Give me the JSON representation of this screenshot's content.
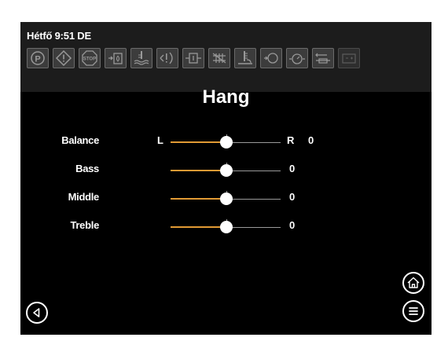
{
  "status": {
    "clock": "Hétfő 9:51 DE"
  },
  "indicators": [
    {
      "name": "parking-brake-icon"
    },
    {
      "name": "warning-icon"
    },
    {
      "name": "stop-icon",
      "text": "STOP"
    },
    {
      "name": "fuel-filter-icon"
    },
    {
      "name": "coolant-temp-icon"
    },
    {
      "name": "transmission-icon"
    },
    {
      "name": "hydraulic-icon"
    },
    {
      "name": "air-filter-icon"
    },
    {
      "name": "oil-level-icon"
    },
    {
      "name": "engine-icon"
    },
    {
      "name": "oil-pressure-icon"
    },
    {
      "name": "glow-plug-icon"
    },
    {
      "name": "battery-icon"
    }
  ],
  "page": {
    "title": "Hang"
  },
  "sliders": [
    {
      "label": "Balance",
      "left": "L",
      "right": "R",
      "value": "0",
      "level": 0.5
    },
    {
      "label": "Bass",
      "value": "0",
      "level": 0.5
    },
    {
      "label": "Middle",
      "value": "0",
      "level": 0.5
    },
    {
      "label": "Treble",
      "value": "0",
      "level": 0.5
    }
  ],
  "colors": {
    "accent": "#e19a34",
    "indicator_bg": "#3c3c3c"
  },
  "nav": {
    "back": "back-icon",
    "home": "home-icon",
    "menu": "menu-icon"
  }
}
